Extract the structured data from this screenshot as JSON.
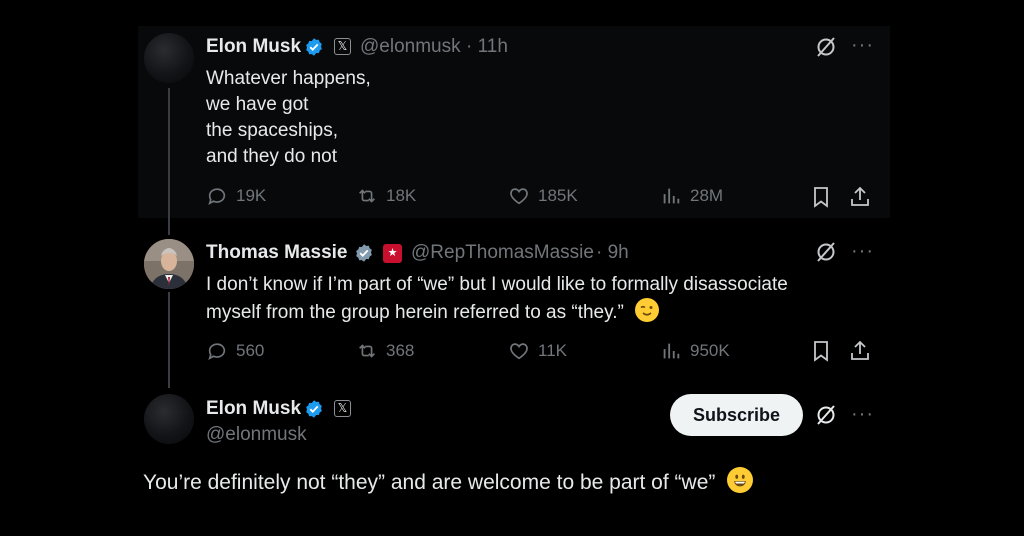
{
  "tweet1": {
    "author": "Elon Musk",
    "handle": "@elonmusk",
    "time": " · 11h",
    "lines": [
      "Whatever happens,",
      "we have got",
      "the spaceships,",
      "and they do not"
    ],
    "metrics": {
      "replies": "19K",
      "reposts": "18K",
      "likes": "185K",
      "views": "28M"
    }
  },
  "tweet2": {
    "author": "Thomas Massie",
    "handle": "@RepThomasMassie",
    "time": " · 9h",
    "lines": [
      "I don’t know if I’m part of “we” but I would like to formally disassociate",
      "myself from the group herein referred to as “they.”"
    ],
    "metrics": {
      "replies": "560",
      "reposts": "368",
      "likes": "11K",
      "views": "950K"
    }
  },
  "tweet3": {
    "author": "Elon Musk",
    "handle": "@elonmusk",
    "subscribe_label": "Subscribe",
    "text": "You’re definitely not “they” and are welcome to be part of “we”"
  },
  "icons": {
    "verified": "verified-badge",
    "affiliate": "x-logo",
    "grok": "grok-icon",
    "more": "more-icon",
    "reply": "reply-icon",
    "repost": "repost-icon",
    "like": "like-icon",
    "views": "views-icon",
    "bookmark": "bookmark-icon",
    "share": "share-icon"
  },
  "colors": {
    "verified": "#1d9bf0",
    "muted": "#71767b",
    "text": "#e7e9ea",
    "background": "#000000"
  }
}
